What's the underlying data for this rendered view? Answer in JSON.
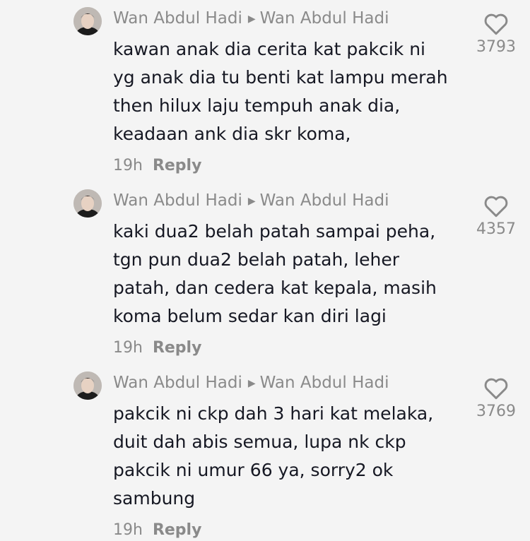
{
  "comments": [
    {
      "author": "Wan Abdul Hadi",
      "reply_to": "Wan Abdul Hadi",
      "lines": [
        "kawan anak dia cerita kat pakcik ni",
        "yg anak dia tu benti kat lampu merah",
        "then hilux laju tempuh anak dia,",
        "keadaan ank dia skr koma,"
      ],
      "time": "19h",
      "reply_label": "Reply",
      "likes": "3793"
    },
    {
      "author": "Wan Abdul Hadi",
      "reply_to": "Wan Abdul Hadi",
      "lines": [
        "kaki dua2 belah patah sampai peha,",
        "tgn pun dua2 belah patah, leher",
        "patah, dan cedera kat kepala, masih",
        "koma belum sedar kan diri lagi"
      ],
      "time": "19h",
      "reply_label": "Reply",
      "likes": "4357"
    },
    {
      "author": "Wan Abdul Hadi",
      "reply_to": "Wan Abdul Hadi",
      "lines": [
        "pakcik ni ckp dah 3 hari kat melaka,",
        "duit dah abis semua, lupa nk ckp",
        "pakcik ni umur 66 ya, sorry2 ok",
        "sambung"
      ],
      "time": "19h",
      "reply_label": "Reply",
      "likes": "3769"
    }
  ],
  "icons": {
    "like": "heart-outline-icon",
    "reply_arrow": "play-arrow-icon"
  },
  "colors": {
    "background": "#f4f4f4",
    "text": "#161823",
    "secondary": "#8a8a8a"
  }
}
